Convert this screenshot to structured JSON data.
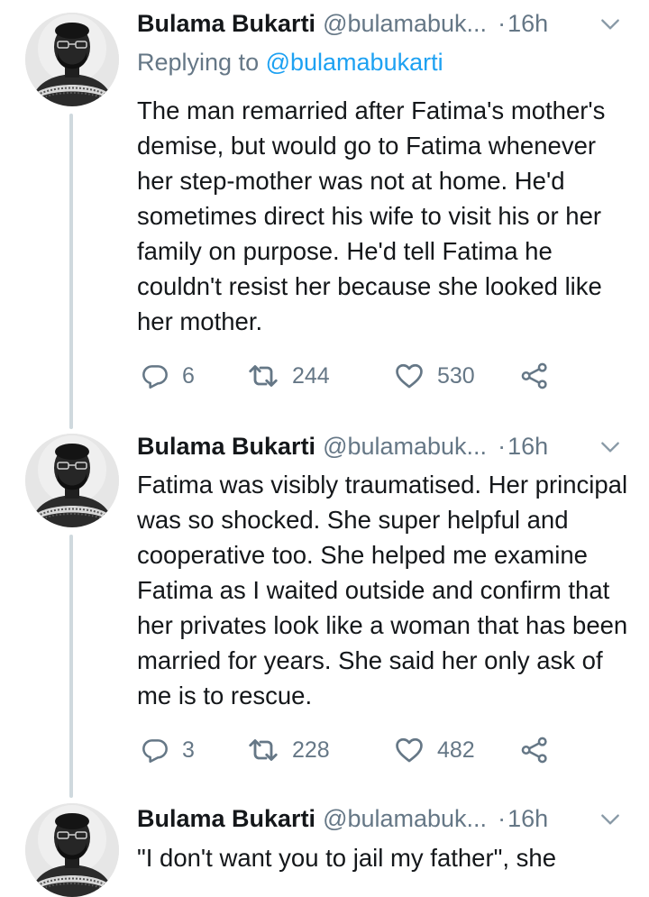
{
  "tweets": [
    {
      "name": "Bulama Bukarti",
      "handle": "@bulamabuk...",
      "dot": "·",
      "time": "16h",
      "replying_prefix": "Replying to ",
      "replying_to": "@bulamabukarti",
      "text": "The man remarried after Fatima's mother's demise, but would go to Fatima whenever her step-mother was not at home. He'd sometimes direct his wife to visit his or her family on purpose. He'd tell Fatima he couldn't resist her because she looked like her mother.",
      "replies": "6",
      "retweets": "244",
      "likes": "530"
    },
    {
      "name": "Bulama Bukarti",
      "handle": "@bulamabuk...",
      "dot": "·",
      "time": "16h",
      "text": "Fatima was visibly traumatised. Her principal was so shocked. She super helpful and cooperative too. She helped me examine Fatima as I waited outside and confirm that her privates look like a woman that has been married for years. She said her only ask of me is to rescue.",
      "replies": "3",
      "retweets": "228",
      "likes": "482"
    },
    {
      "name": "Bulama Bukarti",
      "handle": "@bulamabuk...",
      "dot": "·",
      "time": "16h",
      "text": "\"I don't want you to jail my father\", she"
    }
  ],
  "icons": {
    "reply": "reply-icon",
    "retweet": "retweet-icon",
    "like": "heart-icon",
    "share": "share-icon",
    "caret": "chevron-down-icon",
    "avatar": "avatar"
  },
  "colors": {
    "text": "#14171a",
    "muted": "#657786",
    "link": "#1da1f2",
    "thread_line": "#cfd9de"
  }
}
